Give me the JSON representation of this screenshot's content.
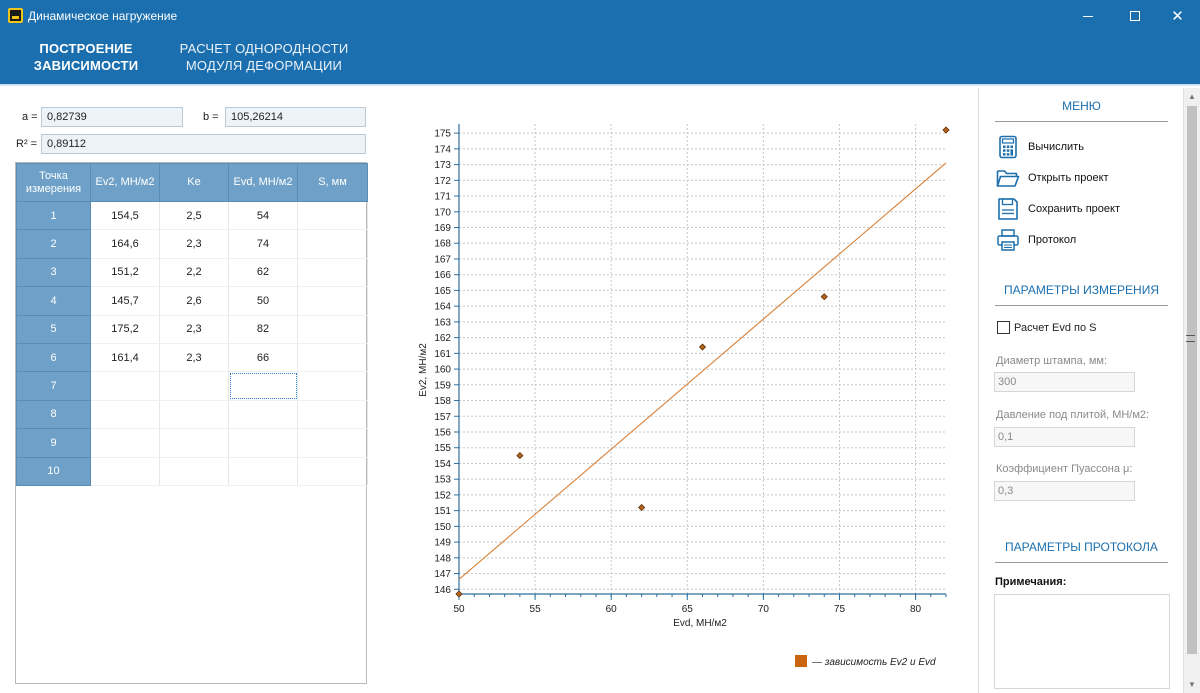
{
  "window": {
    "title": "Динамическое нагружение",
    "close_glyph": "✕"
  },
  "tabs": [
    {
      "label_line1": "ПОСТРОЕНИЕ",
      "label_line2": "ЗАВИСИМОСТИ",
      "active": true
    },
    {
      "label_line1": "РАСЧЕТ ОДНОРОДНОСТИ",
      "label_line2": "МОДУЛЯ ДЕФОРМАЦИИ",
      "active": false
    }
  ],
  "coefficients": {
    "a_label": "a =",
    "a_value": "0,82739",
    "b_label": "b =",
    "b_value": "105,26214",
    "r2_label": "R² =",
    "r2_value": "0,89112"
  },
  "table": {
    "headers": [
      "Точка измерения",
      "Ev2, МН/м2",
      "Ke",
      "Evd, МН/м2",
      "S, мм"
    ],
    "rows": [
      [
        "1",
        "154,5",
        "2,5",
        "54",
        ""
      ],
      [
        "2",
        "164,6",
        "2,3",
        "74",
        ""
      ],
      [
        "3",
        "151,2",
        "2,2",
        "62",
        ""
      ],
      [
        "4",
        "145,7",
        "2,6",
        "50",
        ""
      ],
      [
        "5",
        "175,2",
        "2,3",
        "82",
        ""
      ],
      [
        "6",
        "161,4",
        "2,3",
        "66",
        ""
      ],
      [
        "7",
        "",
        "",
        "",
        ""
      ],
      [
        "8",
        "",
        "",
        "",
        ""
      ],
      [
        "9",
        "",
        "",
        "",
        ""
      ],
      [
        "10",
        "",
        "",
        "",
        ""
      ]
    ]
  },
  "chart_data": {
    "type": "scatter",
    "xlabel": "Evd, МН/м2",
    "ylabel": "Ev2, МН/м2",
    "xlim": [
      50,
      82
    ],
    "ylim": [
      145.7,
      175.2
    ],
    "x_ticks": [
      50,
      55,
      60,
      65,
      70,
      75,
      80
    ],
    "y_ticks": [
      146,
      147,
      148,
      149,
      150,
      151,
      152,
      153,
      154,
      155,
      156,
      157,
      158,
      159,
      160,
      161,
      162,
      163,
      164,
      165,
      166,
      167,
      168,
      169,
      170,
      171,
      172,
      173,
      174,
      175
    ],
    "grid": true,
    "points": [
      {
        "x": 54,
        "y": 154.5
      },
      {
        "x": 74,
        "y": 164.6
      },
      {
        "x": 62,
        "y": 151.2
      },
      {
        "x": 50,
        "y": 145.7
      },
      {
        "x": 82,
        "y": 175.2
      },
      {
        "x": 66,
        "y": 161.4
      }
    ],
    "regression": {
      "a": 0.82739,
      "b": 105.26214,
      "x_from": 50,
      "x_to": 82
    },
    "legend": "— зависимость Ev2 и Evd",
    "legend_position": "bottom-right",
    "point_color": "#b8651b",
    "line_color": "#d9823a"
  },
  "menu": {
    "title": "МЕНЮ",
    "items": [
      {
        "label": "Вычислить",
        "icon": "calculator-icon"
      },
      {
        "label": "Открыть проект",
        "icon": "folder-open-icon"
      },
      {
        "label": "Сохранить проект",
        "icon": "save-icon"
      },
      {
        "label": "Протокол",
        "icon": "printer-icon"
      }
    ]
  },
  "measurement_params": {
    "title": "ПАРАМЕТРЫ ИЗМЕРЕНИЯ",
    "checkbox_label": "Расчет Evd по S",
    "stamp_diameter_label": "Диаметр штампа, мм:",
    "stamp_diameter_value": "300",
    "pressure_label": "Давление под плитой, МН/м2:",
    "pressure_value": "0,1",
    "poisson_label": "Коэффициент Пуассона μ:",
    "poisson_value": "0,3"
  },
  "protocol_params": {
    "title": "ПАРАМЕТРЫ ПРОТОКОЛА",
    "notes_label": "Примечания:",
    "notes_value": ""
  },
  "colors": {
    "accent": "#1c6fae",
    "table_header": "#6fa1c8"
  }
}
